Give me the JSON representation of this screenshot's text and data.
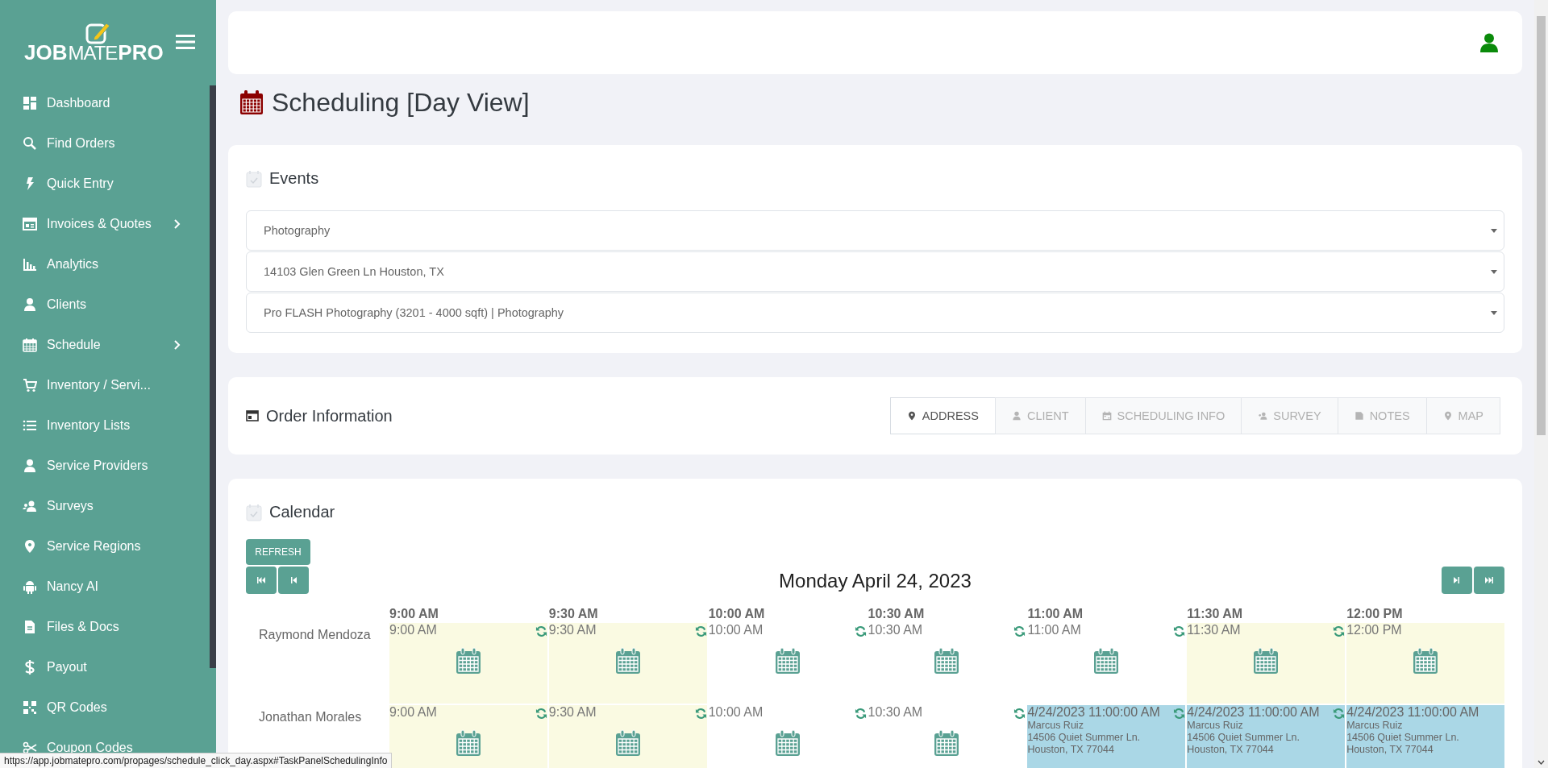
{
  "logo": {
    "part_1": "JOB",
    "part_2": "MATE",
    "part_3": "PRO"
  },
  "sidebar": {
    "items": [
      {
        "label": "Dashboard",
        "has_submenu": false
      },
      {
        "label": "Find Orders",
        "has_submenu": false
      },
      {
        "label": "Quick Entry",
        "has_submenu": false
      },
      {
        "label": "Invoices & Quotes",
        "has_submenu": true
      },
      {
        "label": "Analytics",
        "has_submenu": false
      },
      {
        "label": "Clients",
        "has_submenu": false
      },
      {
        "label": "Schedule",
        "has_submenu": true
      },
      {
        "label": "Inventory / Servi...",
        "has_submenu": false
      },
      {
        "label": "Inventory Lists",
        "has_submenu": false
      },
      {
        "label": "Service Providers",
        "has_submenu": false
      },
      {
        "label": "Surveys",
        "has_submenu": false
      },
      {
        "label": "Service Regions",
        "has_submenu": false
      },
      {
        "label": "Nancy AI",
        "has_submenu": false
      },
      {
        "label": "Files & Docs",
        "has_submenu": false
      },
      {
        "label": "Payout",
        "has_submenu": false
      },
      {
        "label": "QR Codes",
        "has_submenu": false
      },
      {
        "label": "Coupon Codes",
        "has_submenu": false
      }
    ]
  },
  "page_title": "Scheduling [Day View]",
  "events": {
    "title": "Events",
    "selects": [
      {
        "value": "Photography"
      },
      {
        "value": "14103 Glen Green Ln Houston, TX"
      },
      {
        "value": "Pro FLASH Photography (3201 - 4000 sqft) | Photography"
      }
    ]
  },
  "order_information": {
    "title": "Order Information",
    "tabs": [
      {
        "label": "ADDRESS",
        "selected": true
      },
      {
        "label": "CLIENT",
        "selected": false
      },
      {
        "label": "SCHEDULING INFO",
        "selected": false
      },
      {
        "label": "SURVEY",
        "selected": false
      },
      {
        "label": "NOTES",
        "selected": false
      },
      {
        "label": "MAP",
        "selected": false
      }
    ]
  },
  "calendar": {
    "title": "Calendar",
    "refresh_button": "REFRESH",
    "date": "Monday April 24, 2023",
    "time_columns": [
      "9:00 AM",
      "9:30 AM",
      "10:00 AM",
      "10:30 AM",
      "11:00 AM",
      "11:30 AM",
      "12:00 PM"
    ],
    "rows": [
      {
        "name": "Raymond Mendoza",
        "slots": [
          {
            "kind": "available",
            "time": "9:00 AM",
            "refresh": true
          },
          {
            "kind": "available",
            "time": "9:30 AM",
            "refresh": true
          },
          {
            "kind": "empty",
            "time": "10:00 AM",
            "refresh": true
          },
          {
            "kind": "empty",
            "time": "10:30 AM",
            "refresh": true
          },
          {
            "kind": "empty",
            "time": "11:00 AM",
            "refresh": true
          },
          {
            "kind": "available",
            "time": "11:30 AM",
            "refresh": true
          },
          {
            "kind": "available",
            "time": "12:00 PM",
            "refresh": false
          }
        ]
      },
      {
        "name": "Jonathan Morales",
        "slots": [
          {
            "kind": "available",
            "time": "9:00 AM",
            "refresh": true
          },
          {
            "kind": "available",
            "time": "9:30 AM",
            "refresh": true
          },
          {
            "kind": "empty",
            "time": "10:00 AM",
            "refresh": true
          },
          {
            "kind": "empty",
            "time": "10:30 AM",
            "refresh": true
          },
          {
            "kind": "booked",
            "time": "4/24/2023 11:00:00 AM",
            "details": [
              "Marcus Ruiz",
              "14506 Quiet Summer Ln.",
              "Houston, TX 77044"
            ],
            "refresh": true
          },
          {
            "kind": "booked",
            "time": "4/24/2023 11:00:00 AM",
            "details": [
              "Marcus Ruiz",
              "14506 Quiet Summer Ln.",
              "Houston, TX 77044"
            ],
            "refresh": true
          },
          {
            "kind": "booked",
            "time": "4/24/2023 11:00:00 AM",
            "details": [
              "Marcus Ruiz",
              "14506 Quiet Summer Ln.",
              "Houston, TX 77044"
            ],
            "refresh": false
          }
        ]
      }
    ]
  },
  "status_bar": {
    "url": "https://app.jobmatepro.com/propages/schedule_click_day.aspx#TaskPanelSchedulingInfo"
  }
}
